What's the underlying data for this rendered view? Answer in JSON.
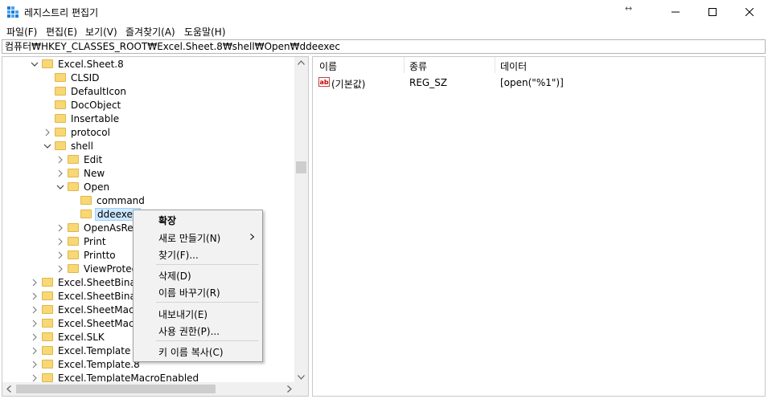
{
  "window": {
    "title": "레지스트리 편집기",
    "resize_hint": "↔"
  },
  "menubar": {
    "items": [
      "파일(F)",
      "편집(E)",
      "보기(V)",
      "즐겨찾기(A)",
      "도움말(H)"
    ]
  },
  "address": {
    "path": "컴퓨터₩HKEY_CLASSES_ROOT₩Excel.Sheet.8₩shell₩Open₩ddeexec"
  },
  "tree": {
    "rows": [
      {
        "label": "Excel.Sheet.8",
        "expanded": "down"
      },
      {
        "label": "CLSID",
        "expanded": "none"
      },
      {
        "label": "DefaultIcon",
        "expanded": "none"
      },
      {
        "label": "DocObject",
        "expanded": "none"
      },
      {
        "label": "Insertable",
        "expanded": "none"
      },
      {
        "label": "protocol",
        "expanded": "right"
      },
      {
        "label": "shell",
        "expanded": "down"
      },
      {
        "label": "Edit",
        "expanded": "right"
      },
      {
        "label": "New",
        "expanded": "right"
      },
      {
        "label": "Open",
        "expanded": "down"
      },
      {
        "label": "command",
        "expanded": "none"
      },
      {
        "label": "ddeexec",
        "expanded": "none",
        "selected": true
      },
      {
        "label": "OpenAsReadOnly",
        "expanded": "right"
      },
      {
        "label": "Print",
        "expanded": "right"
      },
      {
        "label": "Printto",
        "expanded": "right"
      },
      {
        "label": "ViewProtected",
        "expanded": "right"
      },
      {
        "label": "Excel.SheetBinaryMacroEnabled",
        "expanded": "right"
      },
      {
        "label": "Excel.SheetBinaryMacroEnabled.12",
        "expanded": "right"
      },
      {
        "label": "Excel.SheetMacroEnabled",
        "expanded": "right"
      },
      {
        "label": "Excel.SheetMacroEnabled.12",
        "expanded": "right"
      },
      {
        "label": "Excel.SLK",
        "expanded": "right"
      },
      {
        "label": "Excel.Template",
        "expanded": "right"
      },
      {
        "label": "Excel.Template.8",
        "expanded": "right"
      },
      {
        "label": "Excel.TemplateMacroEnabled",
        "expanded": "right"
      }
    ]
  },
  "list": {
    "columns": [
      "이름",
      "종류",
      "데이터"
    ],
    "rows": [
      {
        "name": "(기본값)",
        "type": "REG_SZ",
        "data": "[open(\"%1\")]"
      }
    ]
  },
  "context_menu": {
    "expand": "확장",
    "new": "새로 만들기(N)",
    "find": "찾기(F)...",
    "delete": "삭제(D)",
    "rename": "이름 바꾸기(R)",
    "export": "내보내기(E)",
    "permissions": "사용 권한(P)...",
    "copy_key_name": "키 이름 복사(C)"
  }
}
